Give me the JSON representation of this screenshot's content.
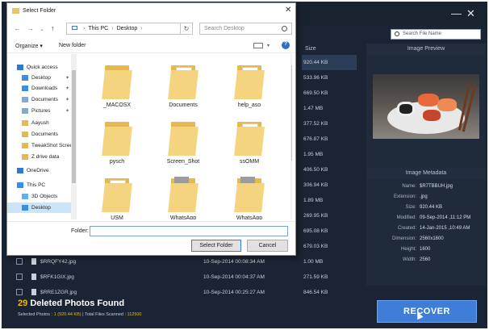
{
  "app": {
    "search_placeholder": "Search File Name",
    "column_size": "Size",
    "preview_title": "Image Preview",
    "metadata_title": "Image Metadata",
    "sizes": [
      "920.44 KB",
      "533.96 KB",
      "669.50 KB",
      "1.47 MB",
      "377.52 KB",
      "676.87 KB",
      "1.95 MB",
      "406.50 KB",
      "306.94 KB",
      "1.89 MB",
      "269.95 KB",
      "695.08 KB",
      "679.03 KB"
    ],
    "rows": [
      {
        "name": "$RRQFY42.jpg",
        "date": "10-Sep-2014 00:08:34 AM",
        "size": "1.00 MB"
      },
      {
        "name": "$RFK1GIX.jpg",
        "date": "10-Sep-2014 00:04:37 AM",
        "size": "271.59 KB"
      },
      {
        "name": "$RRE1ZGR.jpg",
        "date": "10-Sep-2014 00:25:27 AM",
        "size": "846.54 KB"
      }
    ],
    "metadata": [
      {
        "k": "Name:",
        "v": "$R7TBBUH.jpg"
      },
      {
        "k": "Extension:",
        "v": ".jpg"
      },
      {
        "k": "Size:",
        "v": "920.44 KB"
      },
      {
        "k": "Modified:",
        "v": "09-Sep-2014 ,11:12 PM"
      },
      {
        "k": "Created:",
        "v": "14-Jan-2015 ,10:49 AM"
      },
      {
        "k": "Dimension:",
        "v": "2560x1600"
      },
      {
        "k": "Height:",
        "v": "1600"
      },
      {
        "k": "Width:",
        "v": "2560"
      }
    ],
    "found_count": "29",
    "found_label": "Deleted Photos Found",
    "selected_label": "Selected Photos : ",
    "selected_value": "1 (920.44 KB)",
    "total_label": " | Total Files Scanned : ",
    "total_value": "112500",
    "recover_label": "RECOVER",
    "minimize_glyph": "—",
    "close_glyph": "✕"
  },
  "dialog": {
    "title": "Select Folder",
    "close_glyph": "✕",
    "breadcrumb": [
      "This PC",
      "Desktop"
    ],
    "search_placeholder": "Search Desktop",
    "organize_label": "Organize ▾",
    "new_folder_label": "New folder",
    "nav_items": [
      {
        "label": "Quick access",
        "icon": "star-icon",
        "color": "#2f79d0"
      },
      {
        "label": "Desktop",
        "icon": "desktop-icon",
        "color": "#3a8ee6",
        "pin": true
      },
      {
        "label": "Downloads",
        "icon": "download-icon",
        "color": "#3a8ee6",
        "pin": true
      },
      {
        "label": "Documents",
        "icon": "documents-icon",
        "color": "#8aa7c7",
        "pin": true
      },
      {
        "label": "Pictures",
        "icon": "pictures-icon",
        "color": "#8aa7c7",
        "pin": true
      },
      {
        "label": "Aayush",
        "icon": "folder-icon",
        "color": "#e6b94f"
      },
      {
        "label": "Documents",
        "icon": "folder-icon",
        "color": "#e6b94f"
      },
      {
        "label": "TweakShot Scree",
        "icon": "folder-icon",
        "color": "#e6b94f"
      },
      {
        "label": "Z drive data",
        "icon": "folder-icon",
        "color": "#e6b94f"
      },
      {
        "label": "OneDrive",
        "icon": "cloud-icon",
        "color": "#2f79d0"
      },
      {
        "label": "This PC",
        "icon": "pc-icon",
        "color": "#3a8ee6"
      },
      {
        "label": "3D Objects",
        "icon": "3d-objects-icon",
        "color": "#5fb0e8"
      },
      {
        "label": "Desktop",
        "icon": "desktop-icon",
        "color": "#3a8ee6",
        "selected": true
      }
    ],
    "folders": [
      "_MACOSX",
      "Documents",
      "help_aso",
      "pysch",
      "Screen_Shot",
      "ssOMM",
      "USM",
      "WhatsApp",
      "WhatsApp"
    ],
    "folder_label": "Folder:",
    "select_button": "Select Folder",
    "cancel_button": "Cancel"
  }
}
